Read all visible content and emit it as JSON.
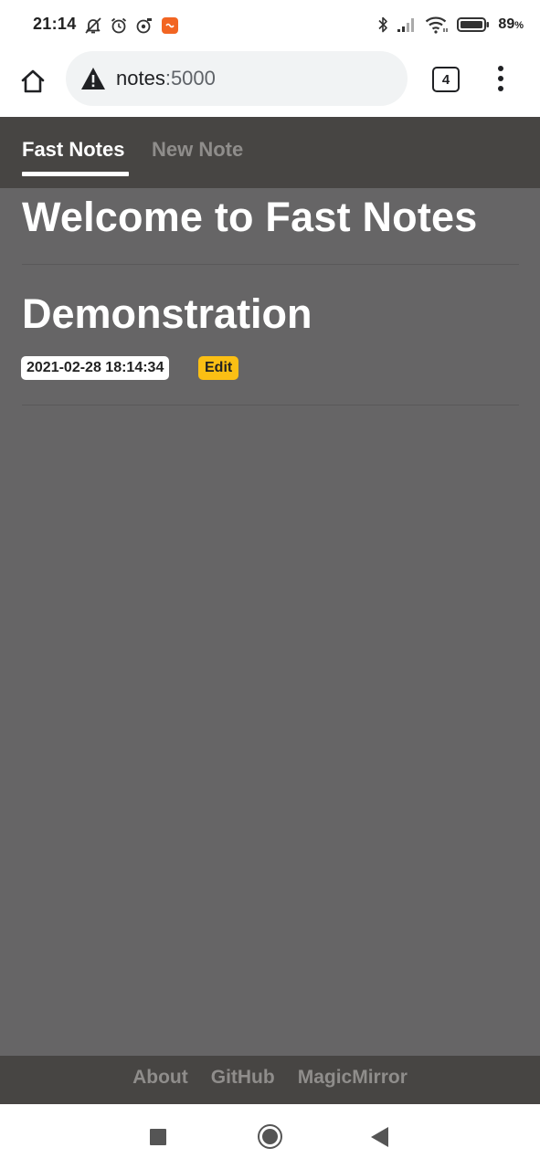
{
  "status_bar": {
    "time": "21:14",
    "battery_percent": "89",
    "battery_unit": "%",
    "left_icons": [
      "mute-alarm-icon",
      "alarm-clock-icon",
      "music-icon",
      "app-notification-icon"
    ],
    "right_icons": [
      "bluetooth-icon",
      "signal-icon",
      "wifi-icon",
      "battery-icon"
    ]
  },
  "browser": {
    "url_host": "notes",
    "url_port": ":5000",
    "tab_count": "4",
    "security_icon": "warning-icon"
  },
  "nav": {
    "items": [
      {
        "label": "Fast Notes",
        "active": true
      },
      {
        "label": "New Note",
        "active": false
      }
    ]
  },
  "main": {
    "heading": "Welcome to Fast Notes",
    "notes": [
      {
        "title": "Demonstration",
        "timestamp": "2021-02-28 18:14:34",
        "edit_label": "Edit"
      }
    ]
  },
  "footer": {
    "links": [
      "About",
      "GitHub",
      "MagicMirror"
    ]
  },
  "colors": {
    "nav_bg": "#474543",
    "content_bg": "#666566",
    "edit_badge": "#fbbf14",
    "inactive_text": "#8f8d8b"
  }
}
